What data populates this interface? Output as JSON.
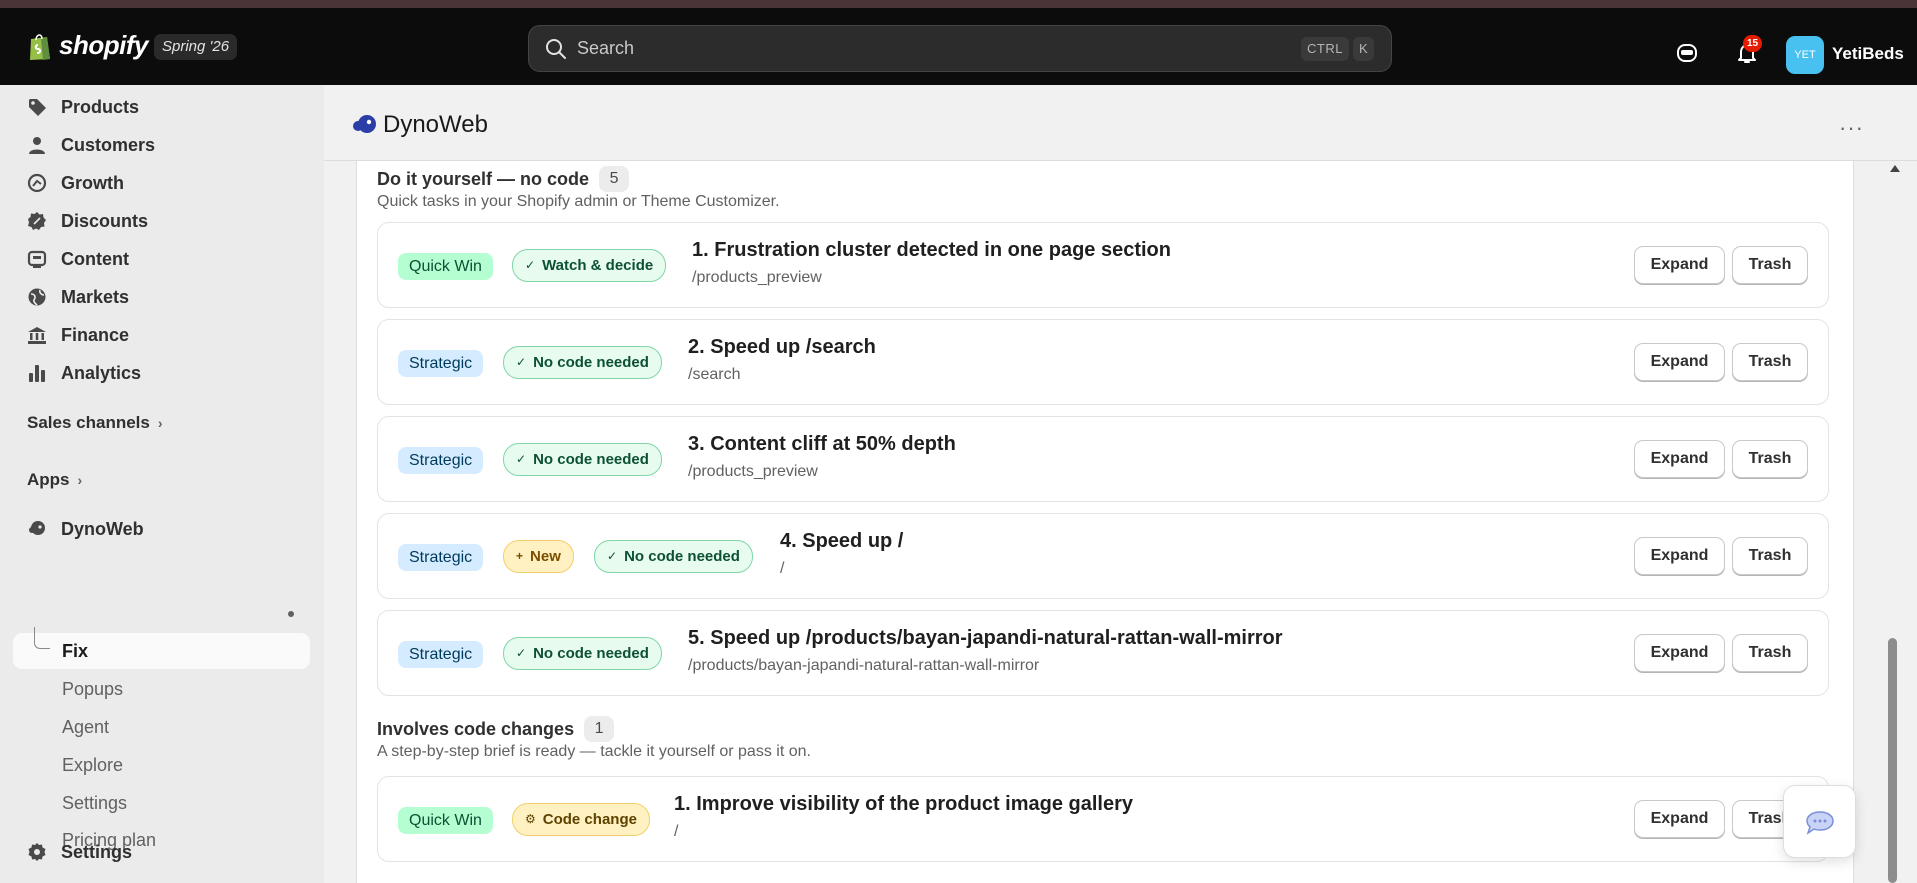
{
  "topbar": {
    "brand": "shopify",
    "release_badge": "Spring '26",
    "search_placeholder": "Search",
    "shortcut_ctrl": "CTRL",
    "shortcut_key": "K",
    "notification_count": "15",
    "avatar_initials": "YET",
    "store_name": "YetiBeds",
    "avatar_color": "#48c1f0"
  },
  "sidebar": {
    "items": [
      {
        "label": "Products",
        "icon": "tag-icon"
      },
      {
        "label": "Customers",
        "icon": "person-icon"
      },
      {
        "label": "Growth",
        "icon": "growth-icon"
      },
      {
        "label": "Discounts",
        "icon": "discount-icon"
      },
      {
        "label": "Content",
        "icon": "content-icon"
      },
      {
        "label": "Markets",
        "icon": "globe-icon"
      },
      {
        "label": "Finance",
        "icon": "bank-icon"
      },
      {
        "label": "Analytics",
        "icon": "bar-chart-icon"
      }
    ],
    "sales_channels": "Sales channels",
    "apps": "Apps",
    "app_name": "DynoWeb",
    "sub_items": [
      "Fix",
      "Popups",
      "Agent",
      "Explore",
      "Settings",
      "Pricing plan"
    ],
    "settings": "Settings"
  },
  "app": {
    "title": "DynoWeb",
    "more": "···"
  },
  "groups": {
    "diy": {
      "title": "Do it yourself — no code",
      "count": "5",
      "subtitle": "Quick tasks in your Shopify admin or Theme Customizer."
    },
    "code": {
      "title": "Involves code changes",
      "count": "1",
      "subtitle": "A step-by-step brief is ready — tackle it yourself or pass it on."
    }
  },
  "tasks": [
    {
      "priority": "Quick Win",
      "tag": "Watch & decide",
      "title": "1. Frustration cluster detected in one page section",
      "path": "/products_preview"
    },
    {
      "priority": "Strategic",
      "tag": "No code needed",
      "title": "2. Speed up /search",
      "path": "/search"
    },
    {
      "priority": "Strategic",
      "tag": "No code needed",
      "title": "3. Content cliff at 50% depth",
      "path": "/products_preview"
    },
    {
      "priority": "Strategic",
      "new_tag": "New",
      "tag": "No code needed",
      "title": "4. Speed up /",
      "path": "/"
    },
    {
      "priority": "Strategic",
      "tag": "No code needed",
      "title": "5. Speed up /products/bayan-japandi-natural-rattan-wall-mirror",
      "path": "/products/bayan-japandi-natural-rattan-wall-mirror"
    },
    {
      "priority": "Quick Win",
      "tag": "Code change",
      "title": "1. Improve visibility of the product image gallery",
      "path": "/"
    }
  ],
  "actions": {
    "expand": "Expand",
    "trash": "Trash"
  },
  "colors": {
    "quick_win_bg": "#b4fed2",
    "strategic_bg": "#d5ebff",
    "no_code_bg": "#e7fbef",
    "new_bg": "#fff1c2"
  }
}
